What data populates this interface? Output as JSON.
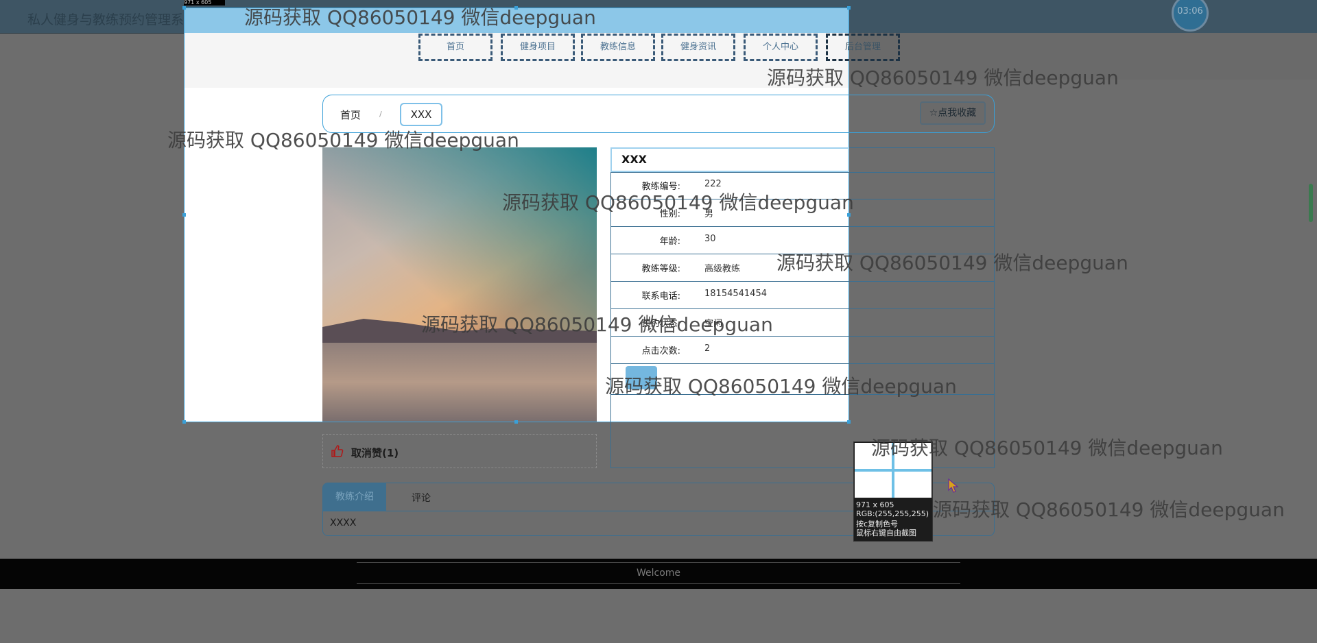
{
  "app": {
    "title": "私人健身与教练预约管理系统",
    "clock": "03:06"
  },
  "nav": {
    "items": [
      "首页",
      "健身项目",
      "教练信息",
      "健身资讯",
      "个人中心",
      "后台管理"
    ]
  },
  "breadcrumb": {
    "home": "首页",
    "separator": "/",
    "current": "XXX"
  },
  "favorite_button": "☆点我收藏",
  "coach": {
    "name": "XXX",
    "fields": [
      {
        "label": "教练编号:",
        "value": "222"
      },
      {
        "label": "性别:",
        "value": "男"
      },
      {
        "label": "年龄:",
        "value": "30"
      },
      {
        "label": "教练等级:",
        "value": "高级教练"
      },
      {
        "label": "联系电话:",
        "value": "18154541454"
      },
      {
        "label": "预约状态:",
        "value": "空闲"
      },
      {
        "label": "点击次数:",
        "value": "2"
      }
    ]
  },
  "like": {
    "label": "取消赞(1)"
  },
  "tabs": {
    "intro": "教练介绍",
    "comment": "评论",
    "intro_text": "XXXX"
  },
  "footer": {
    "text": "Welcome"
  },
  "screenshot_tool": {
    "size_label": "971 x 605",
    "magnifier": {
      "size": "971 x 605",
      "rgb": "RGB:(255,255,255)",
      "hint1": "按c复制色号",
      "hint2": "鼠标右键自由截图"
    }
  },
  "watermark": "源码获取 QQ86050149 微信deepguan",
  "colors": {
    "accent": "#3aa0d8",
    "header": "#8cc7e8",
    "footer": "#050505"
  }
}
